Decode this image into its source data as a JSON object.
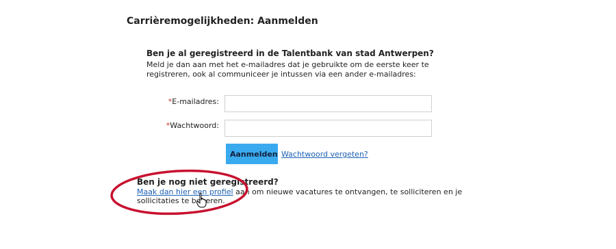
{
  "page": {
    "title": "Carrièremogelijkheden: Aanmelden"
  },
  "login": {
    "heading": "Ben je al geregistreerd in de Talentbank van stad Antwerpen?",
    "description": "Meld je dan aan met het e-mailadres dat je gebruikte om de eerste keer te registreren, ook al communiceer je intussen via een ander e-mailadres:",
    "required_marker": "*",
    "email_label": "E-mailadres:",
    "email_value": "",
    "password_label": "Wachtwoord:",
    "password_value": "",
    "submit_label": "Aanmelden",
    "forgot_link": "Wachtwoord vergeten?"
  },
  "register": {
    "heading": "Ben je nog niet geregistreerd?",
    "link_text": "Maak dan hier een profiel",
    "text_after_link": " aan om nieuwe vacatures te ontvangen, te solliciteren en je sollicitaties te beheren."
  },
  "colors": {
    "accent_button": "#3aaaef",
    "link": "#1a5fb4",
    "annotation_circle": "#c8102e",
    "required_marker": "#c0392b"
  },
  "icons": {
    "cursor": "hand-pointer-icon"
  }
}
